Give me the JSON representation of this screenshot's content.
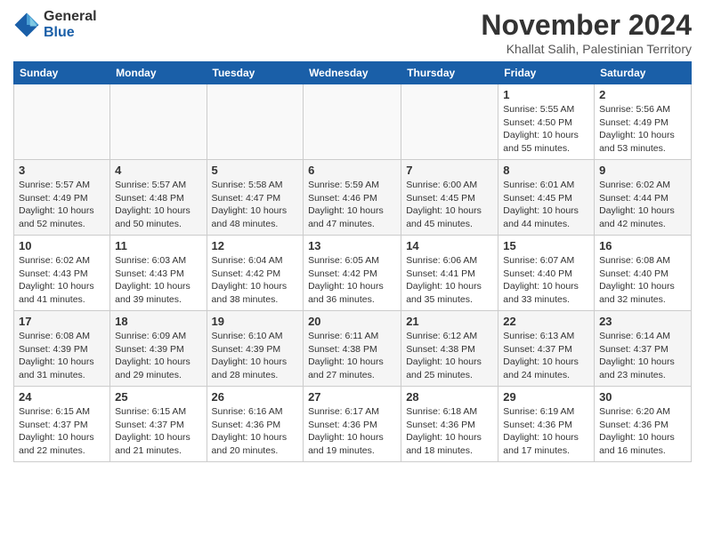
{
  "logo": {
    "general": "General",
    "blue": "Blue"
  },
  "header": {
    "month": "November 2024",
    "location": "Khallat Salih, Palestinian Territory"
  },
  "weekdays": [
    "Sunday",
    "Monday",
    "Tuesday",
    "Wednesday",
    "Thursday",
    "Friday",
    "Saturday"
  ],
  "weeks": [
    [
      {
        "day": "",
        "info": ""
      },
      {
        "day": "",
        "info": ""
      },
      {
        "day": "",
        "info": ""
      },
      {
        "day": "",
        "info": ""
      },
      {
        "day": "",
        "info": ""
      },
      {
        "day": "1",
        "info": "Sunrise: 5:55 AM\nSunset: 4:50 PM\nDaylight: 10 hours\nand 55 minutes."
      },
      {
        "day": "2",
        "info": "Sunrise: 5:56 AM\nSunset: 4:49 PM\nDaylight: 10 hours\nand 53 minutes."
      }
    ],
    [
      {
        "day": "3",
        "info": "Sunrise: 5:57 AM\nSunset: 4:49 PM\nDaylight: 10 hours\nand 52 minutes."
      },
      {
        "day": "4",
        "info": "Sunrise: 5:57 AM\nSunset: 4:48 PM\nDaylight: 10 hours\nand 50 minutes."
      },
      {
        "day": "5",
        "info": "Sunrise: 5:58 AM\nSunset: 4:47 PM\nDaylight: 10 hours\nand 48 minutes."
      },
      {
        "day": "6",
        "info": "Sunrise: 5:59 AM\nSunset: 4:46 PM\nDaylight: 10 hours\nand 47 minutes."
      },
      {
        "day": "7",
        "info": "Sunrise: 6:00 AM\nSunset: 4:45 PM\nDaylight: 10 hours\nand 45 minutes."
      },
      {
        "day": "8",
        "info": "Sunrise: 6:01 AM\nSunset: 4:45 PM\nDaylight: 10 hours\nand 44 minutes."
      },
      {
        "day": "9",
        "info": "Sunrise: 6:02 AM\nSunset: 4:44 PM\nDaylight: 10 hours\nand 42 minutes."
      }
    ],
    [
      {
        "day": "10",
        "info": "Sunrise: 6:02 AM\nSunset: 4:43 PM\nDaylight: 10 hours\nand 41 minutes."
      },
      {
        "day": "11",
        "info": "Sunrise: 6:03 AM\nSunset: 4:43 PM\nDaylight: 10 hours\nand 39 minutes."
      },
      {
        "day": "12",
        "info": "Sunrise: 6:04 AM\nSunset: 4:42 PM\nDaylight: 10 hours\nand 38 minutes."
      },
      {
        "day": "13",
        "info": "Sunrise: 6:05 AM\nSunset: 4:42 PM\nDaylight: 10 hours\nand 36 minutes."
      },
      {
        "day": "14",
        "info": "Sunrise: 6:06 AM\nSunset: 4:41 PM\nDaylight: 10 hours\nand 35 minutes."
      },
      {
        "day": "15",
        "info": "Sunrise: 6:07 AM\nSunset: 4:40 PM\nDaylight: 10 hours\nand 33 minutes."
      },
      {
        "day": "16",
        "info": "Sunrise: 6:08 AM\nSunset: 4:40 PM\nDaylight: 10 hours\nand 32 minutes."
      }
    ],
    [
      {
        "day": "17",
        "info": "Sunrise: 6:08 AM\nSunset: 4:39 PM\nDaylight: 10 hours\nand 31 minutes."
      },
      {
        "day": "18",
        "info": "Sunrise: 6:09 AM\nSunset: 4:39 PM\nDaylight: 10 hours\nand 29 minutes."
      },
      {
        "day": "19",
        "info": "Sunrise: 6:10 AM\nSunset: 4:39 PM\nDaylight: 10 hours\nand 28 minutes."
      },
      {
        "day": "20",
        "info": "Sunrise: 6:11 AM\nSunset: 4:38 PM\nDaylight: 10 hours\nand 27 minutes."
      },
      {
        "day": "21",
        "info": "Sunrise: 6:12 AM\nSunset: 4:38 PM\nDaylight: 10 hours\nand 25 minutes."
      },
      {
        "day": "22",
        "info": "Sunrise: 6:13 AM\nSunset: 4:37 PM\nDaylight: 10 hours\nand 24 minutes."
      },
      {
        "day": "23",
        "info": "Sunrise: 6:14 AM\nSunset: 4:37 PM\nDaylight: 10 hours\nand 23 minutes."
      }
    ],
    [
      {
        "day": "24",
        "info": "Sunrise: 6:15 AM\nSunset: 4:37 PM\nDaylight: 10 hours\nand 22 minutes."
      },
      {
        "day": "25",
        "info": "Sunrise: 6:15 AM\nSunset: 4:37 PM\nDaylight: 10 hours\nand 21 minutes."
      },
      {
        "day": "26",
        "info": "Sunrise: 6:16 AM\nSunset: 4:36 PM\nDaylight: 10 hours\nand 20 minutes."
      },
      {
        "day": "27",
        "info": "Sunrise: 6:17 AM\nSunset: 4:36 PM\nDaylight: 10 hours\nand 19 minutes."
      },
      {
        "day": "28",
        "info": "Sunrise: 6:18 AM\nSunset: 4:36 PM\nDaylight: 10 hours\nand 18 minutes."
      },
      {
        "day": "29",
        "info": "Sunrise: 6:19 AM\nSunset: 4:36 PM\nDaylight: 10 hours\nand 17 minutes."
      },
      {
        "day": "30",
        "info": "Sunrise: 6:20 AM\nSunset: 4:36 PM\nDaylight: 10 hours\nand 16 minutes."
      }
    ]
  ]
}
